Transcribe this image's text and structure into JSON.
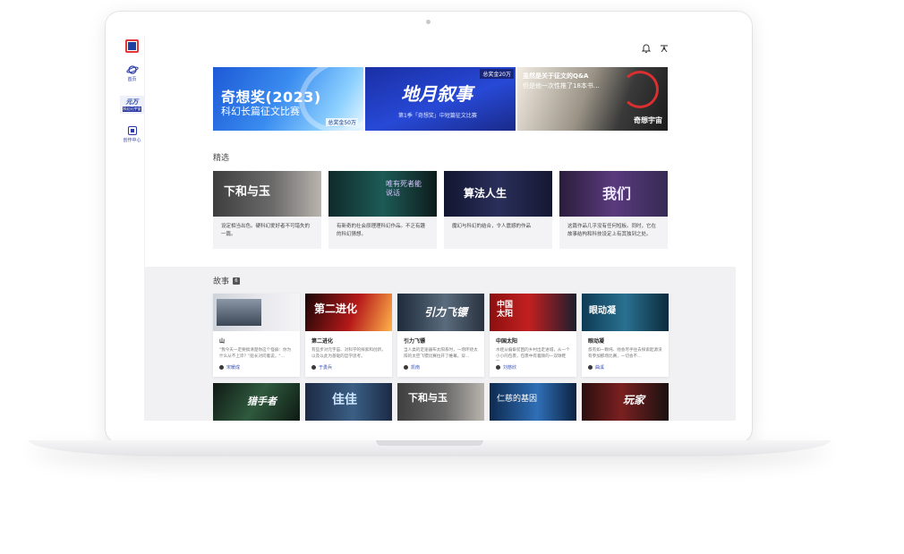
{
  "sidebar": {
    "items": [
      {
        "label": "首页",
        "icon": "planet-icon"
      },
      {
        "label": "元万",
        "sub": "科幻元宇宙",
        "icon": "yuanwan-logo-icon"
      },
      {
        "label": "创作中心",
        "icon": "create-icon"
      }
    ]
  },
  "topbar": {
    "icons": [
      "bell-icon",
      "share-icon"
    ]
  },
  "banners": [
    {
      "title": "奇想奖(2023)",
      "subtitle": "科幻长篇征文比赛",
      "tag": "总奖金50万"
    },
    {
      "title": "地月叙事",
      "subtitle": "第1季「奇想奖」中短篇征文比赛",
      "tag": "总奖金20万"
    },
    {
      "line1": "虽然是关于征文的Q&A",
      "line2": "但是他一次性推了18本书…",
      "brand": "奇想宇宙"
    }
  ],
  "featured": {
    "label": "精选",
    "cards": [
      {
        "title": "下和与玉",
        "desc": "设定相当出色。硬科幻爱好者不可错失的一篇。"
      },
      {
        "title": "唯有死者能说话",
        "desc": "有新奇的社会原理理科幻作品。不乏有趣的科幻猜想。"
      },
      {
        "title": "算法人生",
        "desc": "魔幻与科幻的结合，令人震撼的作品"
      },
      {
        "title": "我们",
        "desc": "这篇作品几乎没有任何短板。同时，它在故事结构和科技设定上有其独到之处。"
      }
    ]
  },
  "stories": {
    "label": "故事",
    "badge": "6",
    "cards": [
      {
        "title": "山",
        "desc": "\"我今天一定要搞清楚你这个怪癖：你为什么从不上岸？\"船长对问着说，\"…",
        "author": "宋暖成"
      },
      {
        "title": "第二进化",
        "desc": "有些步对元宇宙、对科学的探索和创新，以及以此为基础的哲学思考。",
        "author": "于勇兵",
        "img_title": "第二进化"
      },
      {
        "title": "引力飞镖",
        "desc": "当人类的定速器布太阳系时，一场环绕太阳的太空飞镖比赛拉开了帷幕。穿…",
        "author": "凯南",
        "img_title": "引力飞镖"
      },
      {
        "title": "中国太阳",
        "desc": "水娃从偏僻贫困的乡村出走进城，从一个小小的包裹，包裹中有着颇的一双球鞋布…",
        "author": "刘慈欣",
        "img_title": "中国太阳"
      },
      {
        "title": "眼动凝",
        "desc": "叔有如一颗纯、他会尽手往去探索起源没有参加那场比赛，一切会不…",
        "author": "曲溪",
        "img_title": "眼动凝"
      }
    ],
    "row2": [
      {
        "title": "猎手者"
      },
      {
        "title": "佳佳"
      },
      {
        "title": "下和与玉"
      },
      {
        "title": "仁慈的基因"
      },
      {
        "title": "玩家"
      }
    ]
  }
}
